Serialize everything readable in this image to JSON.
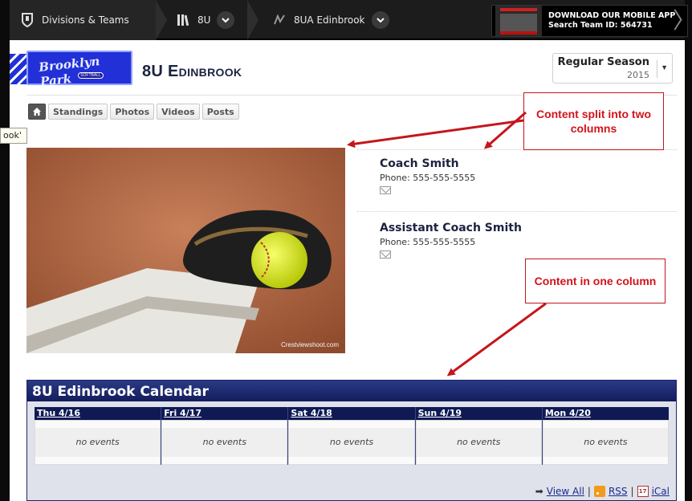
{
  "topnav": {
    "divisions_label": "Divisions & Teams",
    "division_label": "8U",
    "team_label": "8UA Edinbrook",
    "app_promo_line1": "DOWNLOAD OUR MOBILE APP",
    "app_promo_line2": "Search Team ID: 564731"
  },
  "header": {
    "logo_text": "Brooklyn Park",
    "logo_sub": "SOFTBALL",
    "team_title_num": "8U",
    "team_title_name": "Edinbrook",
    "season_name": "Regular Season",
    "season_year": "2015"
  },
  "subnav": {
    "home_icon": "home-icon",
    "items": [
      "Standings",
      "Photos",
      "Videos",
      "Posts"
    ]
  },
  "tooltip": "ook'",
  "coaches": [
    {
      "name": "Coach Smith",
      "phone": "Phone: 555-555-5555"
    },
    {
      "name": "Assistant Coach Smith",
      "phone": "Phone: 555-555-5555"
    }
  ],
  "photo": {
    "credit": "Crestviewshoot.com"
  },
  "callouts": {
    "two_col": "Content split into two columns",
    "one_col": "Content in one column"
  },
  "calendar": {
    "title": "8U Edinbrook Calendar",
    "days": [
      {
        "label": "Thu 4/16",
        "events": "no events"
      },
      {
        "label": "Fri 4/17",
        "events": "no events"
      },
      {
        "label": "Sat 4/18",
        "events": "no events"
      },
      {
        "label": "Sun 4/19",
        "events": "no events"
      },
      {
        "label": "Mon 4/20",
        "events": "no events"
      }
    ],
    "view_all": "View All",
    "rss": "RSS",
    "ical": "iCal",
    "ical_icon_text": "17"
  },
  "colors": {
    "navy": "#1b2340",
    "callout_red": "#d3131a",
    "logo_blue": "#2230d8"
  }
}
